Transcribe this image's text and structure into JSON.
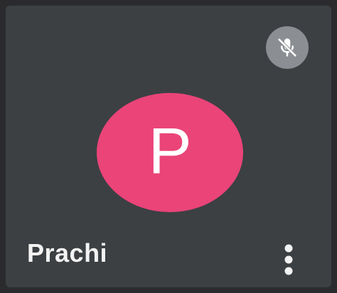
{
  "participant": {
    "name": "Prachi",
    "initial": "P",
    "avatar_color": "#ea4479"
  },
  "status": {
    "mic_muted": true,
    "mic_icon": "mic-off-icon"
  },
  "actions": {
    "more_icon": "more-vert-icon"
  },
  "colors": {
    "tile_background": "#3c4043",
    "badge_background": "#8b8e92",
    "text": "#f3f3f3"
  }
}
